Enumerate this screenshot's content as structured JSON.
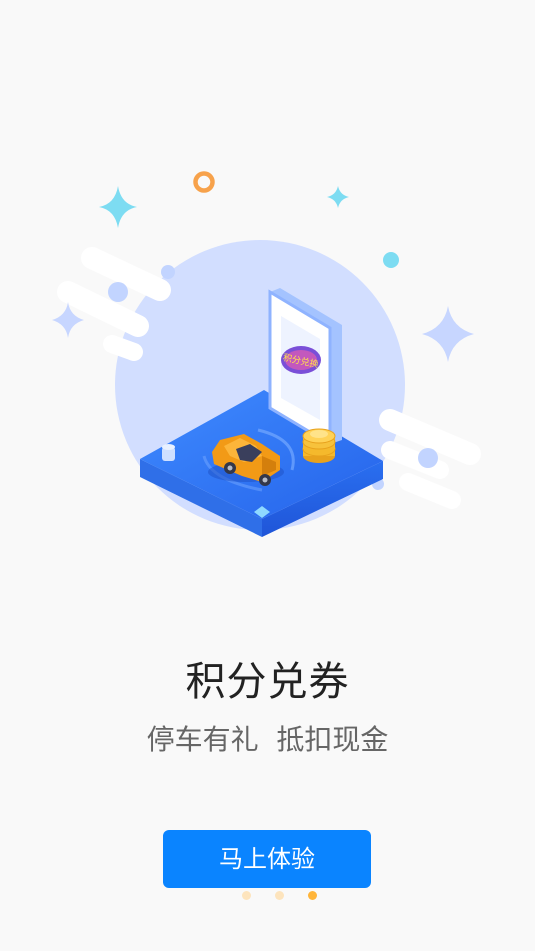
{
  "onboarding": {
    "title": "积分兑券",
    "subtitle": "停车有礼  抵扣现金",
    "cta_label": "马上体验",
    "illustration_sign_text": "积分兑换",
    "page_indicator": {
      "total": 3,
      "active_index": 3
    }
  },
  "colors": {
    "background": "#f9f9f9",
    "accent": "#0a84ff",
    "dot_active": "#ffb53a",
    "dot_inactive": "#fde4bd",
    "title": "#222222",
    "subtitle": "#666666"
  }
}
